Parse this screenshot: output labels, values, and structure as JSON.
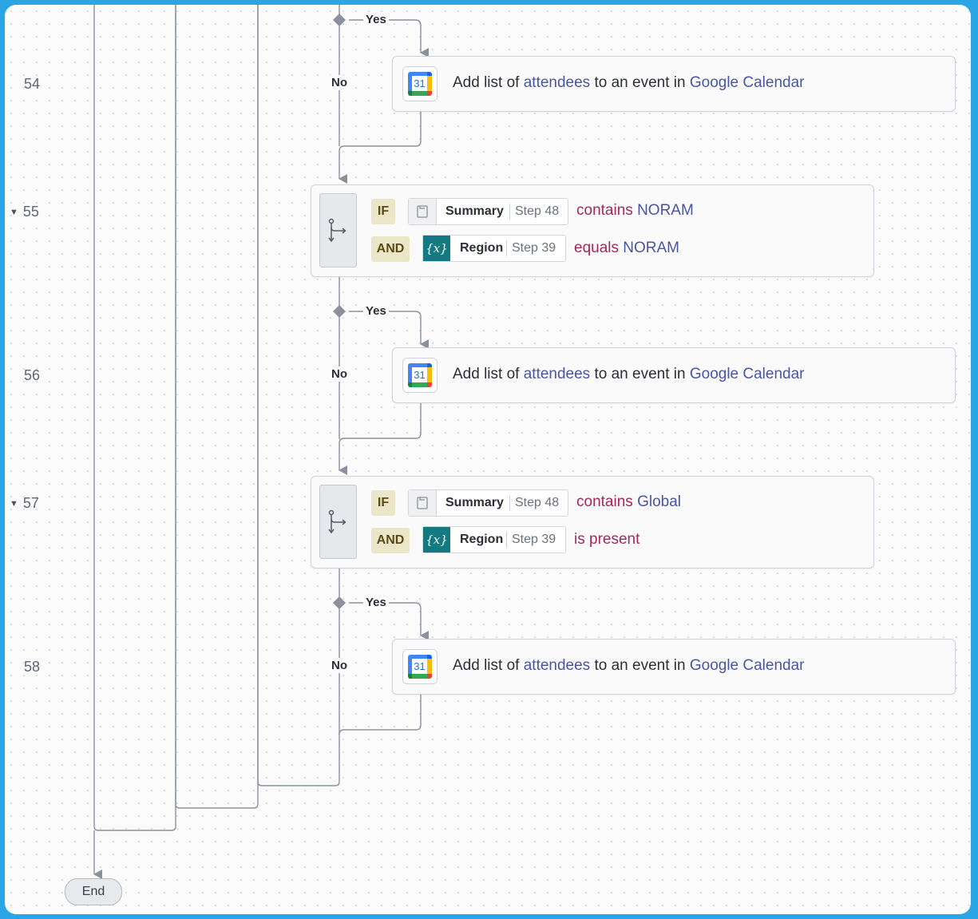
{
  "lines": [
    {
      "number": "54",
      "collapsible": false
    },
    {
      "number": "55",
      "collapsible": true
    },
    {
      "number": "56",
      "collapsible": false
    },
    {
      "number": "57",
      "collapsible": true
    },
    {
      "number": "58",
      "collapsible": false
    }
  ],
  "branch_labels": {
    "yes": "Yes",
    "no": "No"
  },
  "actions": [
    {
      "prefix": "Add list of ",
      "field": "attendees",
      "middle": " to an event in ",
      "app": "Google Calendar",
      "icon": "google-calendar-icon",
      "icon_day": "31"
    },
    {
      "prefix": "Add list of ",
      "field": "attendees",
      "middle": " to an event in ",
      "app": "Google Calendar",
      "icon": "google-calendar-icon",
      "icon_day": "31"
    },
    {
      "prefix": "Add list of ",
      "field": "attendees",
      "middle": " to an event in ",
      "app": "Google Calendar",
      "icon": "google-calendar-icon",
      "icon_day": "31"
    }
  ],
  "conditions": [
    {
      "icon": "branch-icon",
      "rows": [
        {
          "operator": "IF",
          "pill_icon": "summary-icon",
          "name": "Summary",
          "step": "Step 48",
          "keyword": "contains",
          "value": "NORAM"
        },
        {
          "operator": "AND",
          "pill_icon": "variable-icon",
          "pill_icon_text": "{x}",
          "name": "Region",
          "step": "Step 39",
          "keyword": "equals",
          "value": "NORAM"
        }
      ]
    },
    {
      "icon": "branch-icon",
      "rows": [
        {
          "operator": "IF",
          "pill_icon": "summary-icon",
          "name": "Summary",
          "step": "Step 48",
          "keyword": "contains",
          "value": "Global"
        },
        {
          "operator": "AND",
          "pill_icon": "variable-icon",
          "pill_icon_text": "{x}",
          "name": "Region",
          "step": "Step 39",
          "keyword": "is present",
          "value": ""
        }
      ]
    }
  ],
  "end_label": "End",
  "colors": {
    "frame_border": "#2aa6e6",
    "link": "#4a55a2",
    "keyword": "#a3285a",
    "variable_badge": "#127a80",
    "operator_badge": "#ece6c8"
  }
}
